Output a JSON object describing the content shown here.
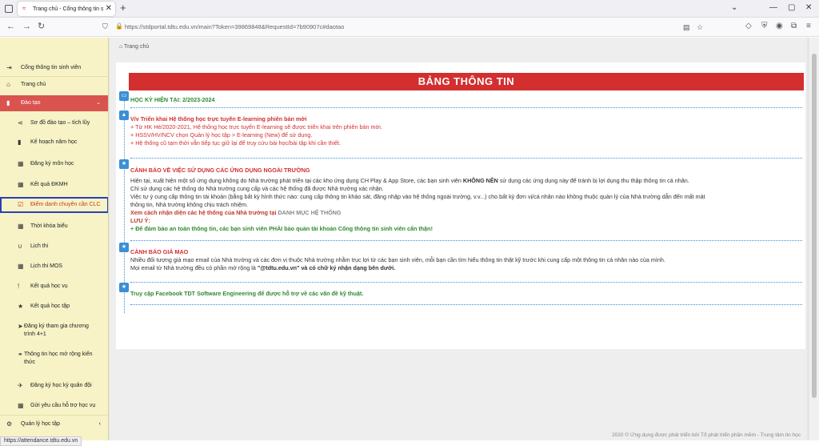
{
  "browser": {
    "tab_title": "Trang chủ - Cổng thông tin sinh",
    "tab_close": "✕",
    "new_tab": "+",
    "url": "https://stdportal.tdtu.edu.vn/main?Token=39869848&RequestId=7b90907c#daotao",
    "status_url": "https://attendance.tdtu.edu.vn"
  },
  "breadcrumb": "Trang chủ",
  "sidebar": {
    "items": [
      {
        "label": "Cổng thông tin sinh viên",
        "icon": "sign-in-icon"
      },
      {
        "label": "Trang chủ",
        "icon": "home-icon"
      },
      {
        "label": "Đào tạo",
        "icon": "book-icon"
      },
      {
        "label": "Sơ đồ đào tạo – tích lũy",
        "icon": "share-icon"
      },
      {
        "label": "Kế hoạch năm học",
        "icon": "book-icon"
      },
      {
        "label": "Đăng ký môn học",
        "icon": "calendar-icon"
      },
      {
        "label": "Kết quả ĐKMH",
        "icon": "calendar-icon"
      },
      {
        "label": "Điểm danh chuyên cần CLC",
        "icon": "check-square-icon"
      },
      {
        "label": "Thời khóa biểu",
        "icon": "calendar-icon"
      },
      {
        "label": "Lịch thi",
        "icon": "magnet-icon"
      },
      {
        "label": "Lịch thi MOS",
        "icon": "calendar-icon"
      },
      {
        "label": "Kết quả học vụ",
        "icon": "exclamation-icon"
      },
      {
        "label": "Kết quả học tập",
        "icon": "star-icon"
      },
      {
        "label": "Đăng ký tham gia chương trình 4+1",
        "icon": "send-icon"
      },
      {
        "label": "Thông tin học mở rộng kiến thức",
        "icon": "link-icon"
      },
      {
        "label": "Đăng ký học kỳ quân đội",
        "icon": "plane-icon"
      },
      {
        "label": "Gửi yêu cầu hỗ trợ học vụ",
        "icon": "calendar-icon"
      },
      {
        "label": "Quản lý học tập",
        "icon": "gear-icon"
      }
    ]
  },
  "board": {
    "title": "BẢNG THÔNG TIN",
    "semester": "HỌC KỲ HIỆN TẠI: 2/2023-2024",
    "elearning": {
      "heading": "V/v Triển khai Hệ thống học trực tuyến E-learning phiên bản mới",
      "lines": [
        "+ Từ HK Hè/2020-2021, Hệ thống học trực tuyến E-learning sẽ được triển khai trên phiên bản mới.",
        "+ HSSV/HV/NCV chọn Quản lý học tập > E-learning (New) để sử dụng.",
        "+ Hệ thống cũ tạm thời vẫn tiếp tục giữ lại để truy cứu bài học/bài tập khi cần thiết."
      ]
    },
    "apps_warning": {
      "heading": "CẢNH BÁO VỀ VIỆC SỬ DỤNG CÁC ỨNG DỤNG NGOÀI TRƯỜNG",
      "line1_pre": "Hiện tại, xuất hiện một số ứng dụng không do Nhà trường phát triển tại các kho ứng dụng CH Play & App Store, các bạn sinh viên ",
      "line1_bold": "KHÔNG NÊN",
      "line1_post": " sử dụng các ứng dụng này để tránh bị lợi dụng thu thập thông tin cá nhân.",
      "line2": "Chỉ sử dụng các hệ thống do Nhà trường cung cấp và các hệ thống đã được Nhà trường xác nhận.",
      "line3": "Việc tự ý cung cấp thông tin tài khoản (bằng bất kỳ hình thức nào: cung cấp thông tin khảo sát, đăng nhập vào hệ thống ngoài trường, v.v...) cho bất kỳ đơn vị/cá nhân nào không thuộc quản lý của Nhà trường dẫn đến mất mát",
      "line4": "thông tin, Nhà trường không chịu trách nhiệm.",
      "link_pre": "Xem cách nhận diện các hệ thống của Nhà trường tại ",
      "link_text": "DANH MỤC HỆ THỐNG",
      "note_label": "LƯU Ý:",
      "note": "+ Để đảm bảo an toàn thông tin, các bạn sinh viên PHẢI bảo quản tài khoản Cổng thông tin sinh viên cẩn thận!"
    },
    "phishing": {
      "heading": "CẢNH BÁO GIẢ MẠO",
      "line1": "Nhiều đối tượng giả mạo email của Nhà trường và các đơn vị thuộc Nhà trường nhằm trục lợi từ các bạn sinh viên, mỗi bạn cần tìm hiểu thông tin thật kỹ trước khi cung cấp một thông tin cá nhân nào của mình.",
      "line2_pre": "Mọi email từ Nhà trường đều có phần mở rộng là ",
      "line2_bold": "\"@tdtu.edu.vn\" và có chữ ký nhận dạng bên dưới."
    },
    "facebook": {
      "link": "Truy cập Facebook TDT Software Engineering",
      "rest": " để được hỗ trợ về các vấn đề kỹ thuật."
    }
  },
  "footer": "2020 © Ứng dụng được phát triển bởi Tổ phát triển phần mềm - Trung tâm tin học",
  "colors": {
    "accent_red": "#d32f2f",
    "badge_blue": "#3b8fd6",
    "sidebar_bg": "#f7f3c6",
    "green": "#2e8b2e"
  }
}
